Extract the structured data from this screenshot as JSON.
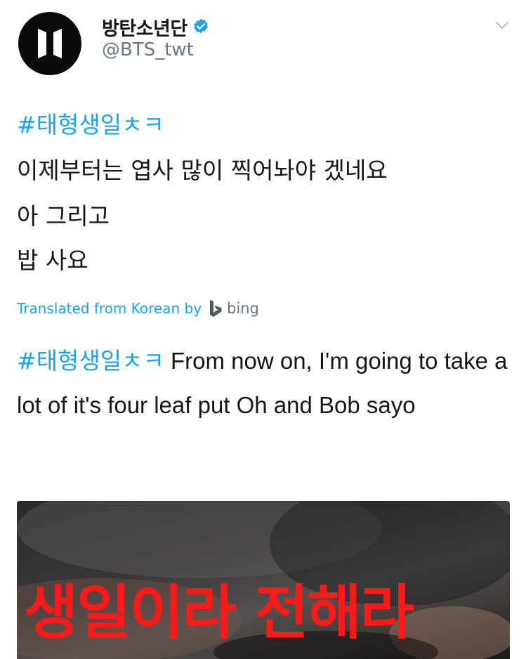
{
  "tweet": {
    "display_name": "방탄소년단",
    "handle": "@BTS_twt",
    "body": {
      "line1_hashtag": "#태형생일ㅊㅋ",
      "line2": "이제부터는 엽사 많이 찍어놔야 겠네요",
      "line3": "아 그리고",
      "line4": "밥 사요"
    },
    "translated_label": "Translated from Korean by",
    "translator": "bing",
    "translation": {
      "hashtag": "#태형생일ㅊㅋ",
      "text": "From now on, I'm going to take a lot of it's four leaf put Oh and Bob sayo"
    },
    "media": {
      "overlay_text": "생일이라 전해라"
    }
  },
  "colors": {
    "link_blue": "#1da1f2",
    "text_dark": "#14171a",
    "text_gray": "#657786",
    "overlay_red": "#ff1a1a"
  },
  "icons": {
    "avatar": "bts-logo-icon",
    "verified": "verified-badge-icon",
    "caret": "chevron-down-icon",
    "bing": "bing-logo-icon"
  }
}
